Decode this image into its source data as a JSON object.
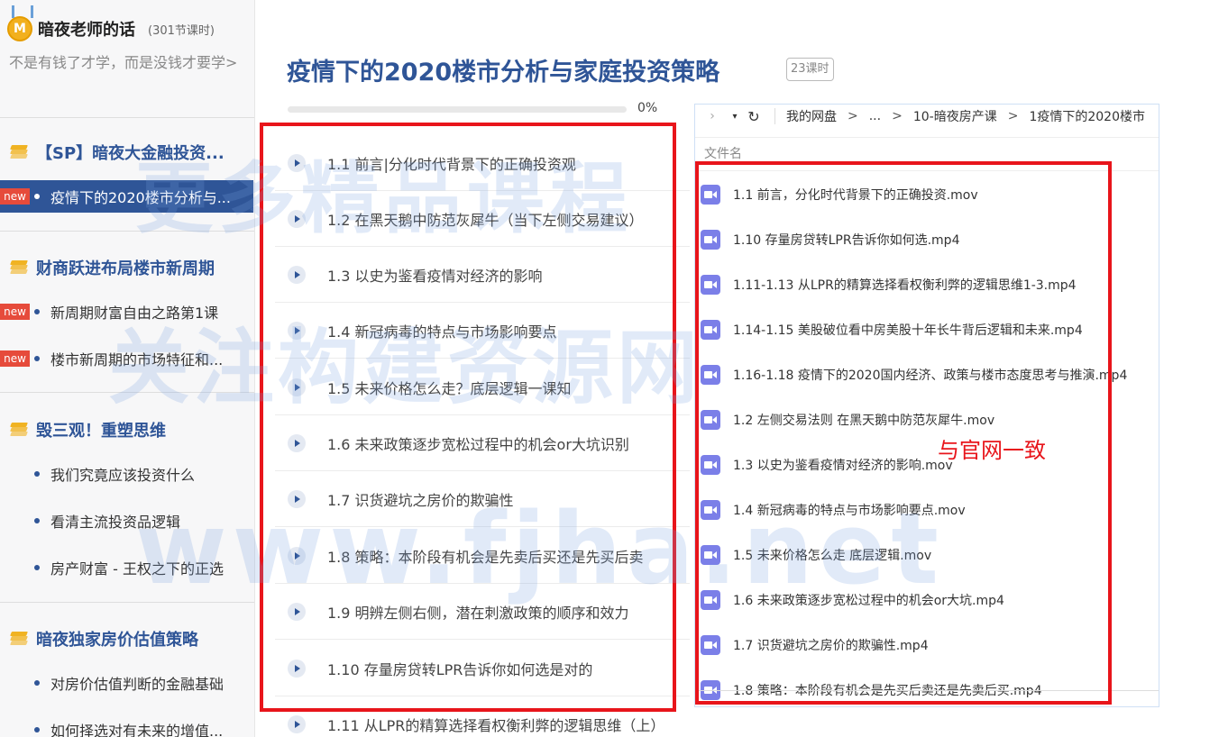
{
  "sidebar": {
    "teacher_name": "暗夜老师的话",
    "teacher_badge": "M",
    "lesson_count": "(301节课时)",
    "motto": "不是有钱了才学，而是没钱才要学>",
    "sections": [
      {
        "title": "【SP】暗夜大金融投资...",
        "items": [
          {
            "label": "疫情下的2020楼市分析与...",
            "badge": "new",
            "active": true
          }
        ]
      },
      {
        "title": "财商跃进布局楼市新周期",
        "items": [
          {
            "label": "新周期财富自由之路第1课",
            "badge": "new",
            "active": false
          },
          {
            "label": "楼市新周期的市场特征和...",
            "badge": "new",
            "active": false
          }
        ]
      },
      {
        "title": "毁三观！重塑思维",
        "items": [
          {
            "label": "我们究竟应该投资什么",
            "badge": "",
            "active": false
          },
          {
            "label": "看清主流投资品逻辑",
            "badge": "",
            "active": false
          },
          {
            "label": "房产财富 - 王权之下的正选",
            "badge": "",
            "active": false
          }
        ]
      },
      {
        "title": "暗夜独家房价估值策略",
        "items": [
          {
            "label": "对房价估值判断的金融基础",
            "badge": "",
            "active": false
          },
          {
            "label": "如何择选对有未来的增值...",
            "badge": "",
            "active": false
          }
        ]
      }
    ]
  },
  "main": {
    "title": "疫情下的2020楼市分析与家庭投资策略",
    "lesson_tag": "23课时",
    "progress_percent": 0,
    "progress_text": "0%",
    "lessons": [
      "1.1 前言|分化时代背景下的正确投资观",
      "1.2 在黑天鹅中防范灰犀牛（当下左侧交易建议）",
      "1.3 以史为鉴看疫情对经济的影响",
      "1.4 新冠病毒的特点与市场影响要点",
      "1.5 未来价格怎么走？底层逻辑一课知",
      "1.6 未来政策逐步宽松过程中的机会or大坑识别",
      "1.7 识货避坑之房价的欺骗性",
      "1.8 策略：本阶段有机会是先卖后买还是先买后卖",
      "1.9 明辨左侧右侧，潜在刺激政策的顺序和效力",
      "1.10 存量房贷转LPR告诉你如何选是对的",
      "1.11 从LPR的精算选择看权衡利弊的逻辑思维（上）"
    ]
  },
  "file_panel": {
    "nav_back": "›",
    "dropdown": "▾",
    "refresh": "↻",
    "breadcrumb": [
      "我的网盘",
      "...",
      "10-暗夜房产课",
      "1疫情下的2020楼市"
    ],
    "breadcrumb_sep": ">",
    "column_header": "文件名",
    "files": [
      "1.1 前言，分化时代背景下的正确投资.mov",
      "1.10 存量房贷转LPR告诉你如何选.mp4",
      "1.11-1.13 从LPR的精算选择看权衡利弊的逻辑思维1-3.mp4",
      "1.14-1.15 美股破位看中房美股十年长牛背后逻辑和未来.mp4",
      "1.16-1.18 疫情下的2020国内经济、政策与楼市态度思考与推演.mp4",
      "1.2 左侧交易法则 在黑天鹅中防范灰犀牛.mov",
      "1.3 以史为鉴看疫情对经济的影响.mov",
      "1.4 新冠病毒的特点与市场影响要点.mov",
      "1.5 未来价格怎么走 底层逻辑.mov",
      "1.6 未来政策逐步宽松过程中的机会or大坑.mp4",
      "1.7 识货避坑之房价的欺骗性.mp4",
      "1.8 策略：本阶段有机会是先买后卖还是先卖后买.mp4"
    ]
  },
  "annotation": "与官网一致",
  "watermark": {
    "line1": "更多精品课程",
    "line2": "关注构建资源网",
    "line3": "www.fjha.net"
  },
  "colors": {
    "brand_blue": "#2f5597",
    "badge_red": "#e64b3b",
    "annotation_red": "#e8151b",
    "video_icon": "#7b7fe8",
    "section_icon": "#f0b323"
  }
}
